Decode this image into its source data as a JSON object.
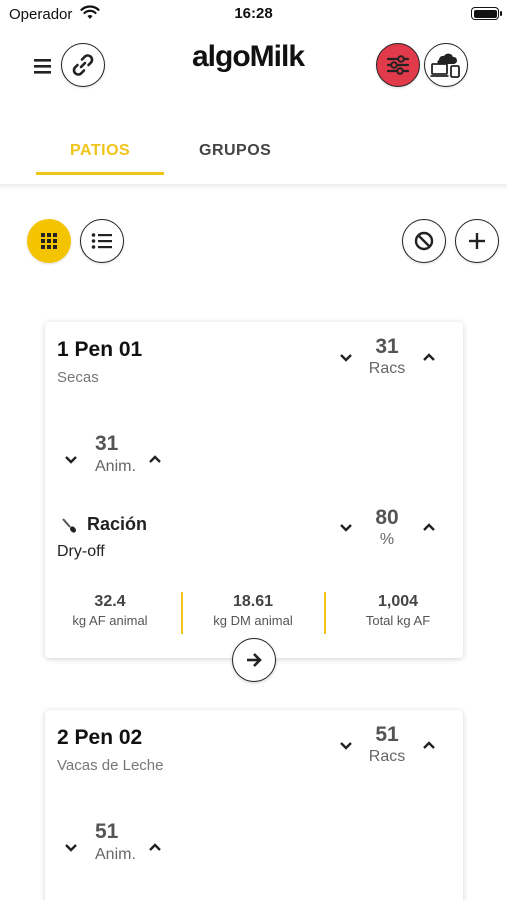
{
  "status_bar": {
    "carrier": "Operador",
    "time": "16:28",
    "battery_level": 1.0
  },
  "header": {
    "logo": "algoMilk",
    "icons": [
      "menu-icon",
      "link-icon",
      "filter-icon",
      "cloud-devices-icon"
    ],
    "filter_color": "#e03a4b"
  },
  "tabs": [
    {
      "label": "PATIOS",
      "active": true
    },
    {
      "label": "GRUPOS",
      "active": false
    }
  ],
  "accent_color": "#f0c419",
  "pens": [
    {
      "title": "1 Pen 01",
      "subtitle": "Secas",
      "racs_value": "31",
      "racs_label": "Racs",
      "anim_value": "31",
      "anim_label": "Anim.",
      "ration_label": "Ración",
      "ration_name": "Dry-off",
      "percent_value": "80",
      "percent_label": "%",
      "stats": [
        {
          "value": "32.4",
          "label": "kg AF animal"
        },
        {
          "value": "18.61",
          "label": "kg DM animal"
        },
        {
          "value": "1,004",
          "label": "Total kg AF"
        }
      ]
    },
    {
      "title": "2 Pen 02",
      "subtitle": "Vacas de Leche",
      "racs_value": "51",
      "racs_label": "Racs",
      "anim_value": "51",
      "anim_label": "Anim."
    }
  ]
}
